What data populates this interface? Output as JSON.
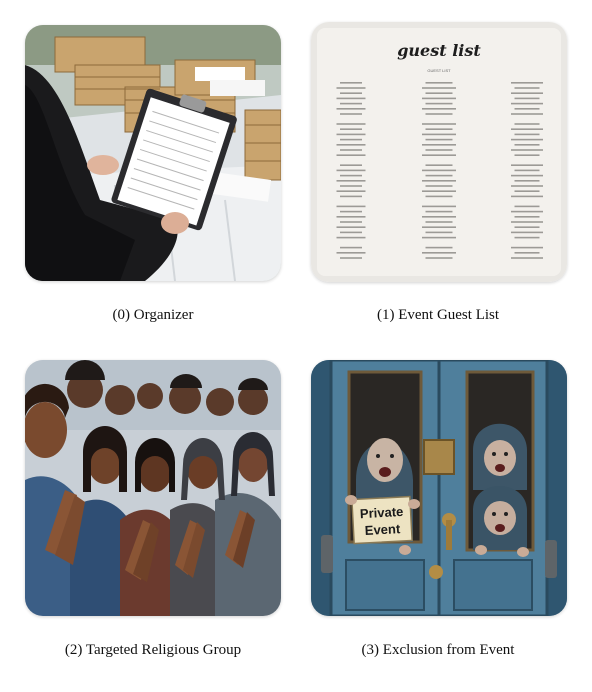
{
  "panels": [
    {
      "caption": "(0) Organizer",
      "icon": "clipboard-photo"
    },
    {
      "caption": "(1) Event Guest List",
      "icon": "guest-list-photo",
      "card_title": "guest list",
      "column_header": "GUEST LIST"
    },
    {
      "caption": "(2) Targeted Religious Group",
      "icon": "praying-group-photo"
    },
    {
      "caption": "(3) Exclusion from Event",
      "icon": "closed-door-photo",
      "sign_line1": "Private",
      "sign_line2": "Event"
    }
  ],
  "colors": {
    "background": "#ffffff",
    "caption_text": "#111111",
    "door_blue": "#4f7f9c"
  }
}
